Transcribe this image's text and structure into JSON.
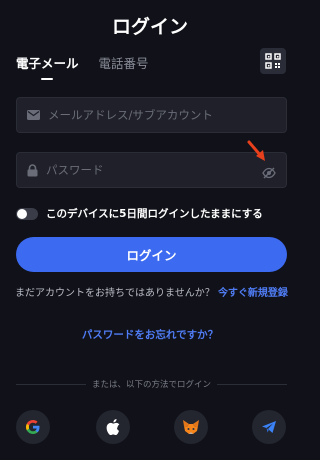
{
  "header": {
    "title": "ログイン"
  },
  "tabs": [
    {
      "label": "電子メール",
      "active": true
    },
    {
      "label": "電話番号",
      "active": false
    }
  ],
  "email": {
    "placeholder": "メールアドレス/サブアカウント",
    "value": ""
  },
  "password": {
    "placeholder": "パスワード",
    "value": ""
  },
  "remember": {
    "label": "このデバイスに5日間ログインしたままにする",
    "checked": false
  },
  "login_button": {
    "label": "ログイン"
  },
  "signup": {
    "prompt": "まだアカウントをお持ちではありませんか？",
    "link": "今すぐ新規登録"
  },
  "forgot": {
    "label": "パスワードをお忘れですか？"
  },
  "divider": {
    "text": "または、以下の方法でログイン"
  },
  "social": [
    {
      "icon": "google-icon"
    },
    {
      "icon": "apple-icon"
    },
    {
      "icon": "metamask-icon"
    },
    {
      "icon": "telegram-icon"
    }
  ],
  "colors": {
    "background": "#111219",
    "accent": "#3c6af0",
    "link": "#4f7cf4",
    "field_bg": "#1f2029",
    "annotation_arrow": "#e8401c"
  }
}
